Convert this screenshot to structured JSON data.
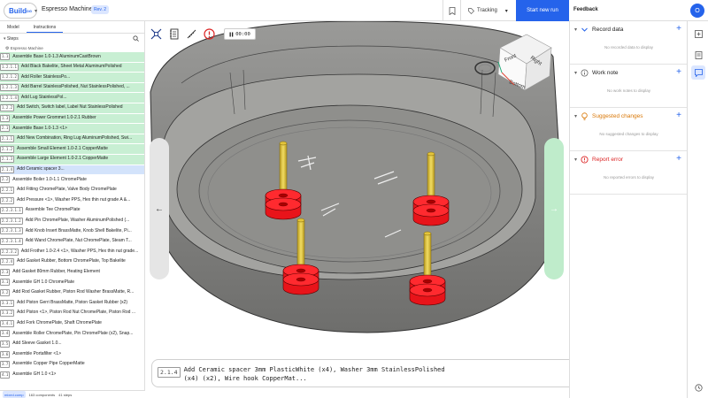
{
  "topbar": {
    "brand": "Build",
    "brand_sup": "DG",
    "project_title": "Espresso Machine",
    "revision_badge": "Rev. 2",
    "tracking_label": "Tracking",
    "start_run_label": "Start new run",
    "feedback_title": "Feedback",
    "avatar_initial": "O"
  },
  "left_panel": {
    "tabs": [
      "Model",
      "Instructions"
    ],
    "steps_heading": "Steps",
    "root_item": "Espresso Machine",
    "steps": [
      {
        "num": "1.1",
        "text": "Assemble Base 1.0-1.3 AluminumCastBrown",
        "status": "done"
      },
      {
        "num": "1.2.1.1",
        "text": "Add Black Bakelite, Sheet Metal AluminumPolished",
        "status": "done"
      },
      {
        "num": "1.2.1.2",
        "text": "Add Roller StainlessPo...",
        "status": "done"
      },
      {
        "num": "1.2.1.3",
        "text": "Add Barrel StainlessPolished, Nut StainlessPolished, ...",
        "status": "done"
      },
      {
        "num": "1.2.1.4",
        "text": "Add Lug StainlessPol...",
        "status": "done"
      },
      {
        "num": "1.2.2",
        "text": "Add Switch, Switch label, Label Nut StainlessPolished",
        "status": "done"
      },
      {
        "num": "1.3",
        "text": "Assemble Power Grommet 1.0-2.1 Rubber",
        "status": "done"
      },
      {
        "num": "2.1",
        "text": "Assemble Base 1.0-1.3 <1>",
        "status": "done"
      },
      {
        "num": "2.1.1",
        "text": "Add New Combination, Ring Lug AluminumPolished, Swi...",
        "status": "done"
      },
      {
        "num": "2.1.2",
        "text": "Assemble Small Element 1.0-2.1 CopperMatte",
        "status": "done"
      },
      {
        "num": "2.1.3",
        "text": "Assemble Large Element 1.0-2.1 CopperMatte",
        "status": "done"
      },
      {
        "num": "2.1.4",
        "text": "Add Ceramic spacer 3...",
        "status": "current"
      },
      {
        "num": "2.2",
        "text": "Assemble Boiler 1.0-1.1 ChromePlate",
        "status": "todo"
      },
      {
        "num": "2.2.1",
        "text": "Add Fitting ChromePlate, Valve Body ChromePlate",
        "status": "todo"
      },
      {
        "num": "2.2.2",
        "text": "Add Pressure <1>, Washer PPS, Hex thin nut grade A &...",
        "status": "todo"
      },
      {
        "num": "2.2.3.1.1",
        "text": "Assemble Tee ChromePlate",
        "status": "todo"
      },
      {
        "num": "2.2.3.1.2",
        "text": "Add Pin ChromePlate, Washer AluminumPolished (...",
        "status": "todo"
      },
      {
        "num": "2.2.3.1.3",
        "text": "Add Knob Insert BrassMatte, Knob Shell Bakelite, Pi...",
        "status": "todo"
      },
      {
        "num": "2.2.3.1.4",
        "text": "Add Wand ChromePlate, Nut ChromePlate, Steam T...",
        "status": "todo"
      },
      {
        "num": "2.2.3.2",
        "text": "Add Frother 1.0-2.4 <1>, Washer PPS, Hex thin nut grade...",
        "status": "todo"
      },
      {
        "num": "2.2.4",
        "text": "Add Gasket Rubber, Bottom ChromePlate, Top Bakelite",
        "status": "todo"
      },
      {
        "num": "2.3",
        "text": "Add Gasket 80mm Rubber, Heating Element",
        "status": "todo"
      },
      {
        "num": "3.1",
        "text": "Assemble GH 1.0 ChromePlate",
        "status": "todo"
      },
      {
        "num": "3.2",
        "text": "Add Rod Gasket Rubber, Piston Rod Washer BrassMatte, R...",
        "status": "todo"
      },
      {
        "num": "3.3.1",
        "text": "Add Piston Gerri BrassMatte, Piston Gasket Rubber (x2)",
        "status": "todo"
      },
      {
        "num": "3.3.2",
        "text": "Add Piston <1>, Piston Rod Nut ChromePlate, Piston Rod ...",
        "status": "todo"
      },
      {
        "num": "3.4.1",
        "text": "Add Fork ChromePlate, Shaft ChromePlate",
        "status": "todo"
      },
      {
        "num": "3.4",
        "text": "Assemble Roller ChromePlate, Pin ChromePlate (x2), Snap...",
        "status": "todo"
      },
      {
        "num": "3.5",
        "text": "Add Sleeve Gasket 1.0...",
        "status": "todo"
      },
      {
        "num": "3.6",
        "text": "Assemble Portafilter <1>",
        "status": "todo"
      },
      {
        "num": "3.7",
        "text": "Assemble Copper Pipe CopperMatte",
        "status": "todo"
      },
      {
        "num": "4.1",
        "text": "Assemble GH 1.0 <1>",
        "status": "todo"
      }
    ],
    "footer": {
      "chip": "mixed.comp",
      "components": "163 components",
      "steps": "41 steps"
    }
  },
  "viewport": {
    "timer": "00:00",
    "viewcube": {
      "front": "Front",
      "right": "Right",
      "bottom": "Bottom"
    },
    "caption_num": "2.1.4",
    "caption_text": "Add Ceramic spacer 3mm PlasticWhite (x4), Washer 3mm StainlessPolished (x4) (x2), Wire hook CopperMat..."
  },
  "feedback": {
    "sections": [
      {
        "title": "Record data",
        "empty": "No recorded data to display",
        "icon": "chevron-icon",
        "color": "#2563eb"
      },
      {
        "title": "Work note",
        "empty": "No work notes to display",
        "icon": "info-icon",
        "color": "#666666"
      },
      {
        "title": "Suggested changes",
        "empty": "No suggested changes to display",
        "icon": "bulb-icon",
        "color": "#d97706"
      },
      {
        "title": "Report error",
        "empty": "No reported errors to display",
        "icon": "error-icon",
        "color": "#dc2626"
      }
    ]
  },
  "colors": {
    "accent": "#2563eb",
    "done_row": "#c8efd3",
    "current_row": "#d3e3fb",
    "spacer_red": "#e8141a",
    "rod_yellow": "#e3c43a",
    "housing_gray": "#8a8a88"
  }
}
